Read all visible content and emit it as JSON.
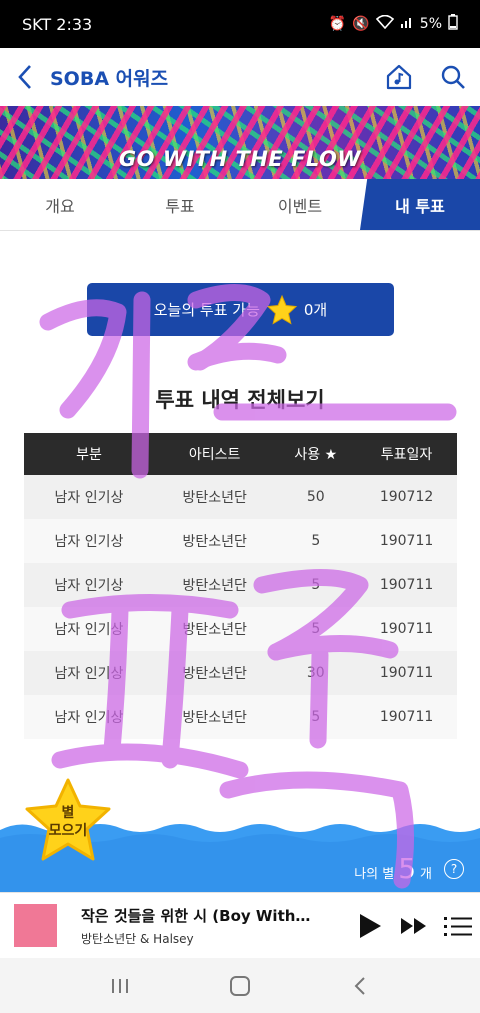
{
  "status": {
    "carrier": "SKT",
    "time": "2:33",
    "battery": "5%"
  },
  "header": {
    "title": "SOBA 어워즈"
  },
  "banner": {
    "text": "GO WITH THE FLOW"
  },
  "tabs": [
    {
      "label": "개요",
      "active": false
    },
    {
      "label": "투표",
      "active": false
    },
    {
      "label": "이벤트",
      "active": false
    },
    {
      "label": "내 투표",
      "active": true
    }
  ],
  "today_vote": {
    "prefix": "오늘의 투표 가능",
    "count": "0개"
  },
  "history": {
    "title": "투표 내역 전체보기",
    "columns": [
      "부분",
      "아티스트",
      "사용 ★",
      "투표일자"
    ],
    "rows": [
      [
        "남자 인기상",
        "방탄소년단",
        "50",
        "190712"
      ],
      [
        "남자 인기상",
        "방탄소년단",
        "5",
        "190711"
      ],
      [
        "남자 인기상",
        "방탄소년단",
        "5",
        "190711"
      ],
      [
        "남자 인기상",
        "방탄소년단",
        "5",
        "190711"
      ],
      [
        "남자 인기상",
        "방탄소년단",
        "30",
        "190711"
      ],
      [
        "남자 인기상",
        "방탄소년단",
        "5",
        "190711"
      ]
    ]
  },
  "collect": {
    "line1": "별",
    "line2": "모으기"
  },
  "my_stars": {
    "label": "나의 별",
    "count": "5",
    "unit": "개",
    "help": "?"
  },
  "player": {
    "title": "작은 것들을 위한 시 (Boy With L..",
    "artist": "방탄소년단 & Halsey"
  },
  "colors": {
    "brand": "#1a47a8",
    "doodle": "#cc66e6",
    "wave": "#3a9cf2",
    "star": "#ffd21a"
  }
}
